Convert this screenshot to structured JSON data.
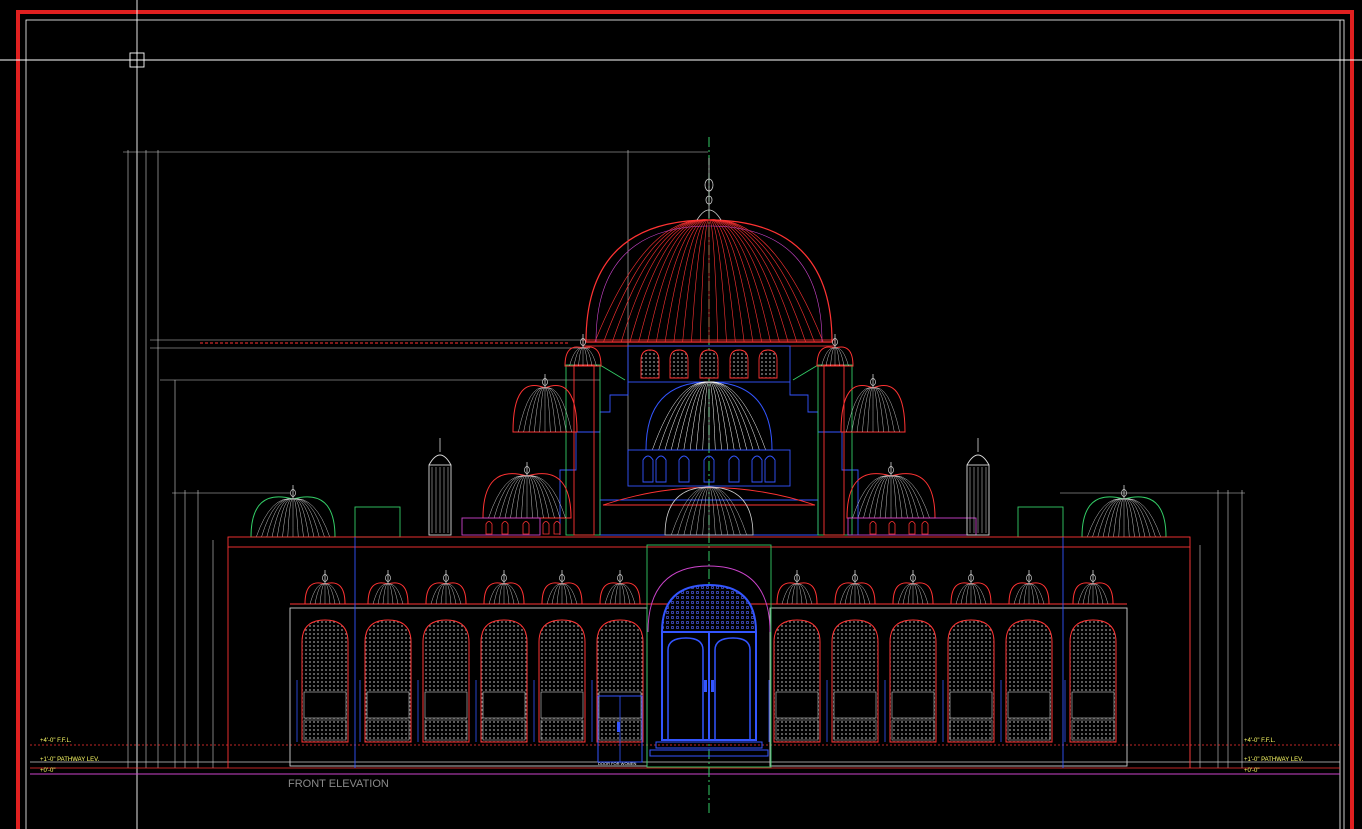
{
  "drawing": {
    "title": "FRONT ELEVATION",
    "left_levels": [
      "+4'-0\" F.F.L.",
      "+1'-0\" PATHWAY LEV.",
      "+0'-0\""
    ],
    "right_levels": [
      "+4'-0\" F.F.L.",
      "+1'-0\" PATHWAY LEV.",
      "+0'-0\""
    ],
    "door_note": "DOOR FOR WOMEN"
  },
  "colors": {
    "background": "#000000",
    "frame": "#e02020",
    "dome": "#ff3333",
    "blue": "#3355ff",
    "green": "#33cc66",
    "white": "#d8d8d8",
    "magenta": "#cc44cc",
    "yellow": "#ffff66"
  }
}
